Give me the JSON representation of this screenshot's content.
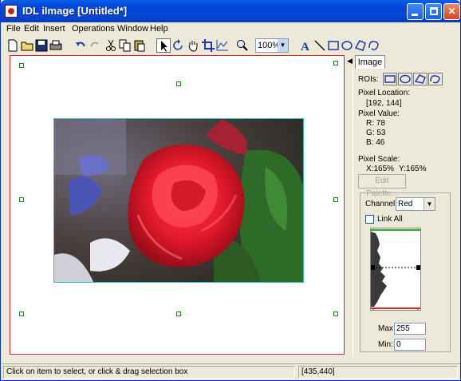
{
  "window": {
    "title": "IDL iImage [Untitled*]"
  },
  "menu": [
    "File",
    "Edit",
    "Insert",
    "Operations",
    "Window",
    "Help"
  ],
  "toolbar": {
    "zoom_value": "100%"
  },
  "tab": {
    "label": "Image"
  },
  "panel": {
    "rois_label": "ROIs:",
    "pixel_location_label": "Pixel Location:",
    "pixel_location_value": "[192, 144]",
    "pixel_value_label": "Pixel Value:",
    "r": "R: 78",
    "g": "G: 53",
    "b": "B: 46",
    "pixel_scale_label": "Pixel Scale:",
    "pixel_scale_x": "X:165%",
    "pixel_scale_y": "Y:165%",
    "edit_palette": "Edit Palette...",
    "channel_label": "Channel:",
    "channel_value": "Red",
    "link_all": "Link All",
    "max_label": "Max",
    "max_value": "255",
    "min_label": "Min:",
    "min_value": "0"
  },
  "status": {
    "message": "Click on item to select, or click & drag selection box",
    "coords": "[435,440]"
  },
  "colors": {
    "titlebar": "#0346d8",
    "canvas_border": "#dd2233",
    "handle": "#0a8f0a",
    "image_border": "#30c0c0"
  }
}
